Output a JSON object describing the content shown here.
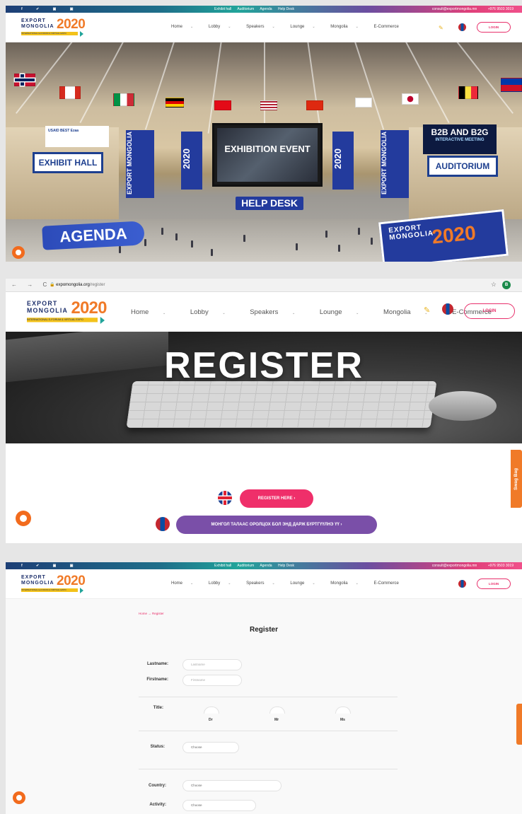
{
  "topstrip": {
    "social": "f ✔ ▣ ▣",
    "links": [
      "Exhibit hall",
      "Auditorium",
      "Agenda",
      "Help Desk"
    ],
    "email": "consult@exportmongolia.mn",
    "phone": "+976 9503 3019"
  },
  "logo": {
    "expo": "EXPORT",
    "mongolia": "MONGOLIA",
    "year": "2020",
    "tagline": "INTERNATIONAL E-FORUM & VIRTUAL EXPO"
  },
  "nav": {
    "items": [
      "Home",
      "Lobby",
      "Speakers",
      "Lounge",
      "Mongolia",
      "E-Commerce"
    ],
    "chevron": "⌄",
    "login": "LOGIN"
  },
  "hall": {
    "exhibit": "EXHIBIT HALL",
    "auditorium": "AUDITORIUM",
    "screen": "EXHIBITION EVENT",
    "helpdesk": "HELP DESK",
    "agenda": "AGENDA",
    "b2b_title": "B2B AND B2G",
    "b2b_sub": "INTERACTIVE MEETING",
    "sponsors": "USAID   BEST   Ezaa",
    "expo_sign_1": "EXPORT",
    "expo_sign_2": "MONGOLIA",
    "expo_sign_year": "2020",
    "banner_year": "2020",
    "banner_text": "EXPORT MONGOLIA"
  },
  "browser": {
    "nav_buttons": "← → C",
    "domain": "expomongolia.org",
    "path": "/register",
    "profile_initial": "B",
    "star": "☆"
  },
  "register_page": {
    "hero_title": "REGISTER",
    "register_button": "REGISTER HERE ›",
    "mongolian_button": "МОНГОЛ ТАЛААС ОРОЛЦОХ БОЛ ЭНД ДАРЖ БҮРТГҮҮЛНЭ ҮҮ ›",
    "swag_tab": "Swag Bag"
  },
  "form": {
    "breadcrumb": "Home → Register",
    "title": "Register",
    "lastname_label": "Lastname:",
    "lastname_placeholder": "Lastname",
    "firstname_label": "Firstname:",
    "firstname_placeholder": "Firstname",
    "title_label": "Title:",
    "title_options": [
      "Dr",
      "Mr",
      "Ms"
    ],
    "status_label": "Status:",
    "status_value": "Choose",
    "country_label": "Country:",
    "country_value": "Choose",
    "activity_label": "Activity:",
    "activity_value": "Choose"
  },
  "colors": {
    "accent_pink": "#ef2f6a",
    "accent_orange": "#f07a28",
    "brand_navy": "#1d2f6b",
    "purple": "#7a4fa8"
  }
}
